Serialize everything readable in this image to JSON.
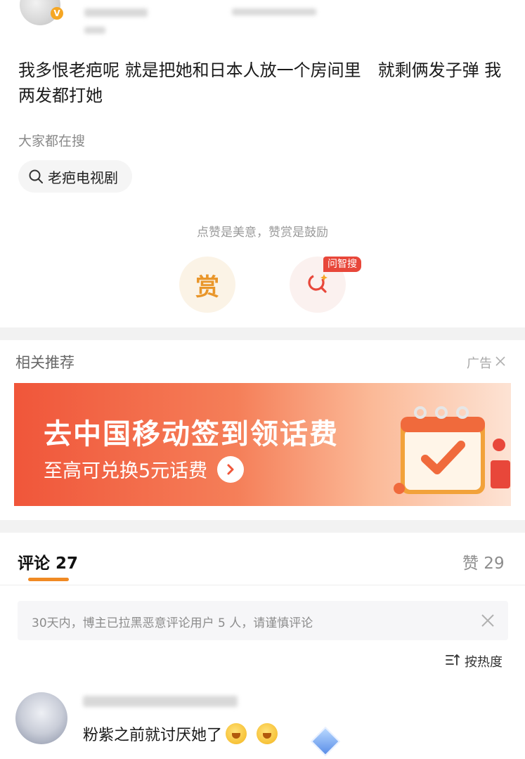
{
  "post": {
    "text": "我多恨老疤呢 就是把她和日本人放一个房间里　就剩俩发子弹 我两发都打她"
  },
  "search_section": {
    "label": "大家都在搜",
    "chip": "老疤电视剧"
  },
  "actions": {
    "hint": "点赞是美意，赞赏是鼓励",
    "reward_glyph": "赏",
    "ask_badge": "问智搜"
  },
  "recommend": {
    "title": "相关推荐",
    "ad_label": "广告"
  },
  "banner": {
    "title": "去中国移动签到领话费",
    "subtitle": "至高可兑换5元话费"
  },
  "comments": {
    "tab_label": "评论 27",
    "likes_label": "赞 29",
    "notice": "30天内，博主已拉黑恶意评论用户 5 人，请谨慎评论",
    "sort_label": "按热度",
    "items": [
      {
        "text": "粉紫之前就讨厌她了"
      }
    ]
  },
  "colors": {
    "accent_orange": "#f08a24",
    "badge_red": "#e8473a",
    "banner_start": "#f0563a"
  }
}
